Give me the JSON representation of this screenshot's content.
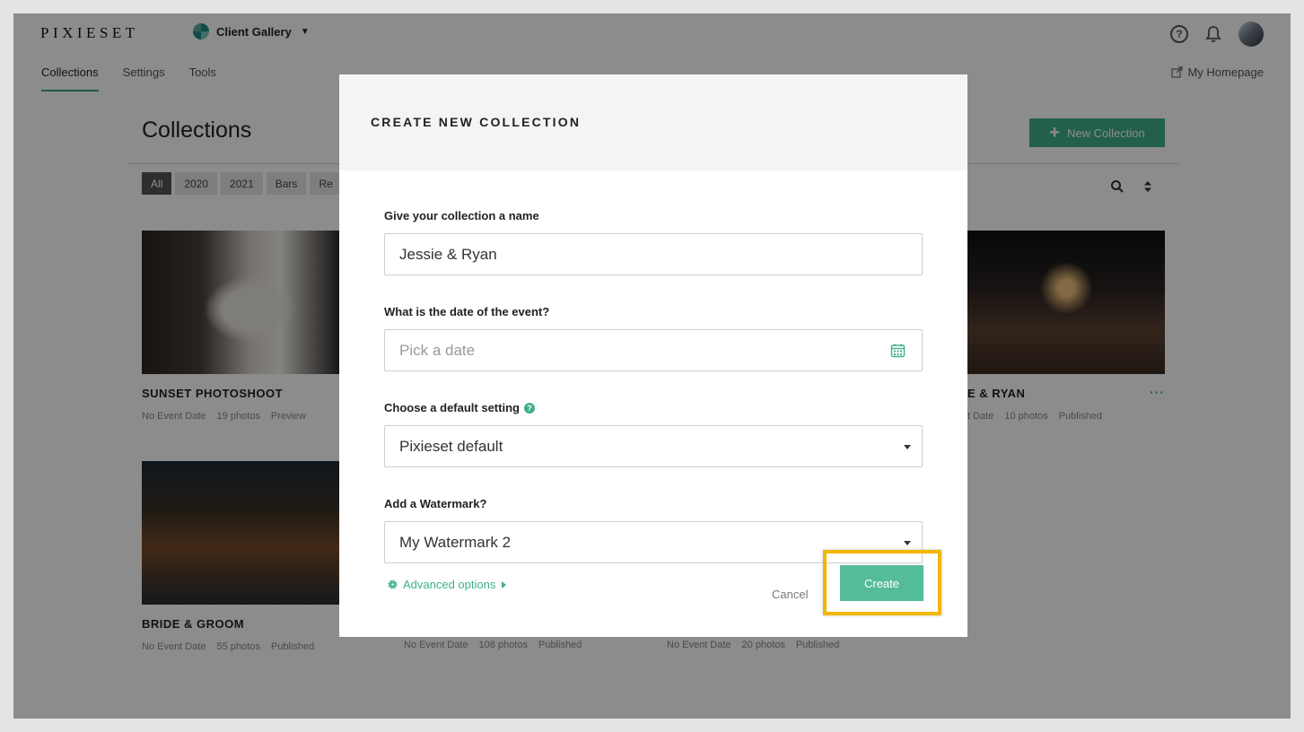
{
  "app": {
    "logo": "PIXIESET",
    "product_switcher": "Client Gallery",
    "help_glyph": "?"
  },
  "nav": {
    "tabs": [
      {
        "label": "Collections",
        "active": true
      },
      {
        "label": "Settings",
        "active": false
      },
      {
        "label": "Tools",
        "active": false
      }
    ],
    "homepage_link": "My Homepage"
  },
  "page": {
    "title": "Collections",
    "new_collection_label": "New Collection",
    "new_collection_glyph": "+",
    "filters": [
      "All",
      "2020",
      "2021",
      "Bars",
      "Re"
    ]
  },
  "collections": [
    {
      "title": "SUNSET PHOTOSHOOT",
      "date": "No Event Date",
      "photos": "19 photos",
      "status": "Preview"
    },
    {
      "title": "E & RYAN",
      "date": "t Date",
      "photos": "10 photos",
      "status": "Published",
      "more": "···"
    },
    {
      "title": "BRIDE & GROOM",
      "date": "No Event Date",
      "photos": "55 photos",
      "status": "Published"
    },
    {
      "date": "No Event Date",
      "photos": "108 photos",
      "status": "Published"
    },
    {
      "date": "No Event Date",
      "photos": "20 photos",
      "status": "Published"
    }
  ],
  "modal": {
    "title": "CREATE NEW COLLECTION",
    "name_label": "Give your collection a name",
    "name_value": "Jessie & Ryan",
    "date_label": "What is the date of the event?",
    "date_placeholder": "Pick a date",
    "setting_label": "Choose a default setting",
    "setting_value": "Pixieset default",
    "setting_info_glyph": "?",
    "watermark_label": "Add a Watermark?",
    "watermark_value": "My Watermark 2",
    "advanced_label": "Advanced options",
    "cancel_label": "Cancel",
    "create_label": "Create"
  },
  "colors": {
    "accent": "#3fae8d",
    "create_button": "#55bc98",
    "highlight": "#f2b705"
  },
  "icons": [
    "help-icon",
    "bell-icon",
    "avatar",
    "external-link-icon",
    "plus-icon",
    "search-icon",
    "sort-icon",
    "calendar-icon",
    "info-icon",
    "gear-icon",
    "caret-down-icon",
    "caret-right-icon",
    "more-icon"
  ]
}
